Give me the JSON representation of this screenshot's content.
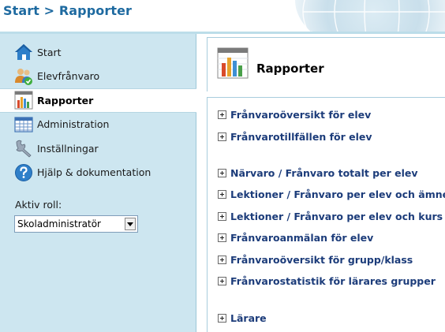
{
  "header": {
    "breadcrumb": "Start > Rapporter"
  },
  "sidebar": {
    "items": [
      {
        "label": "Start",
        "icon": "home-icon",
        "active": false
      },
      {
        "label": "Elevfrånvaro",
        "icon": "student-check-icon",
        "active": false
      },
      {
        "label": "Rapporter",
        "icon": "bar-chart-icon",
        "active": true
      },
      {
        "label": "Administration",
        "icon": "grid-table-icon",
        "active": false
      },
      {
        "label": "Inställningar",
        "icon": "wrench-icon",
        "active": false
      },
      {
        "label": "Hjälp & dokumentation",
        "icon": "help-icon",
        "active": false
      }
    ],
    "role_label": "Aktiv roll:",
    "role_value": "Skoladministratör"
  },
  "main": {
    "title": "Rapporter",
    "reports": [
      "Frånvaroöversikt för elev",
      "Frånvarotillfällen för elev",
      "Närvaro / Frånvaro totalt per elev",
      "Lektioner / Frånvaro per elev och ämne",
      "Lektioner / Frånvaro per elev och kurs",
      "Frånvaroanmälan för elev",
      "Frånvaroöversikt för grupp/klass",
      "Frånvarostatistik för lärares grupper",
      "Lärare"
    ]
  },
  "colors": {
    "accent": "#1e6aa0",
    "sidebar_bg": "#cde6f0",
    "link": "#1c3c7a"
  }
}
